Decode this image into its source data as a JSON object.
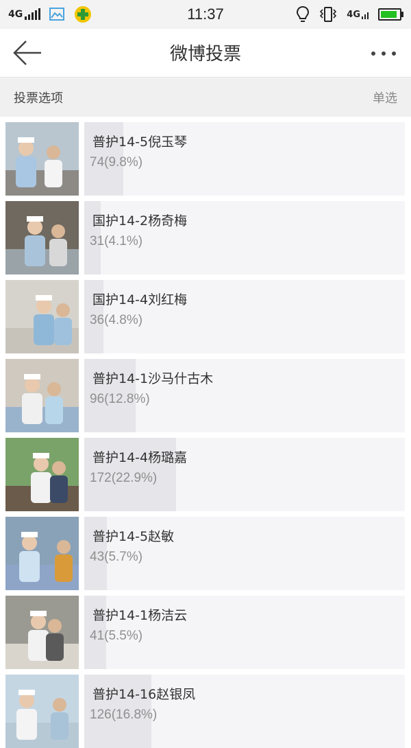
{
  "status_bar": {
    "network_left": "4G",
    "time": "11:37",
    "network_right": "4G",
    "icons": [
      "signal-icon",
      "gallery-icon",
      "app-plus-icon",
      "bulb-icon",
      "vibrate-icon",
      "signal-4g-icon",
      "battery-icon"
    ],
    "battery_level": 0.9,
    "colors": {
      "battery": "#23c021",
      "app_icon": "#f2c500",
      "gallery_icon": "#4aa3df"
    }
  },
  "nav": {
    "title": "微博投票",
    "back_icon": "arrow-left-icon",
    "more_icon": "more-dots-icon"
  },
  "section": {
    "title": "投票选项",
    "type": "单选"
  },
  "options": [
    {
      "label": "普护14-5倪玉琴",
      "count": "74(9.8%)",
      "share": 0.098
    },
    {
      "label": "国护14-2杨奇梅",
      "count": "31(4.1%)",
      "share": 0.041
    },
    {
      "label": "国护14-4刘红梅",
      "count": "36(4.8%)",
      "share": 0.048
    },
    {
      "label": "普护14-1沙马什古木",
      "count": "96(12.8%)",
      "share": 0.128
    },
    {
      "label": "普护14-4杨璐嘉",
      "count": "172(22.9%)",
      "share": 0.229
    },
    {
      "label": "普护14-5赵敏",
      "count": "43(5.7%)",
      "share": 0.057
    },
    {
      "label": "普护14-1杨洁云",
      "count": "41(5.5%)",
      "share": 0.055
    },
    {
      "label": "普护14-16赵银凤",
      "count": "126(16.8%)",
      "share": 0.168
    }
  ],
  "colors": {
    "bar_background": "#f5f5f7",
    "bar_fill": "#e5e5ea",
    "header_background": "#f0f0f0"
  }
}
